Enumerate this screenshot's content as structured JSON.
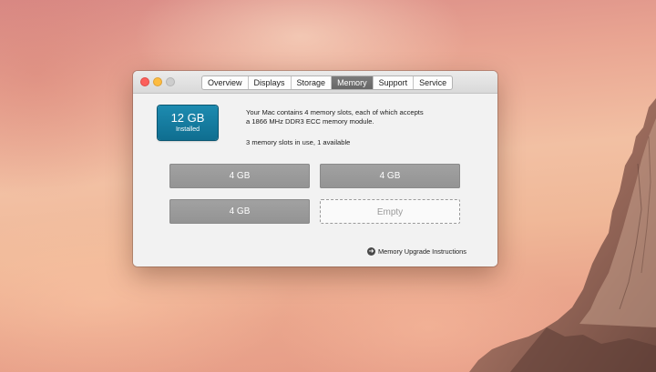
{
  "window": {
    "tabs": [
      {
        "label": "Overview",
        "active": false
      },
      {
        "label": "Displays",
        "active": false
      },
      {
        "label": "Storage",
        "active": false
      },
      {
        "label": "Memory",
        "active": true
      },
      {
        "label": "Support",
        "active": false
      },
      {
        "label": "Service",
        "active": false
      }
    ]
  },
  "memory": {
    "installed_amount": "12 GB",
    "installed_label": "Installed",
    "description_line1": "Your Mac contains 4 memory slots, each of which accepts",
    "description_line2": "a 1866 MHz DDR3 ECC memory module.",
    "usage": "3 memory slots in use, 1 available",
    "slots": [
      {
        "label": "4 GB",
        "state": "filled"
      },
      {
        "label": "4 GB",
        "state": "filled"
      },
      {
        "label": "4 GB",
        "state": "filled"
      },
      {
        "label": "Empty",
        "state": "empty"
      }
    ],
    "upgrade_link": "Memory Upgrade Instructions",
    "upgrade_icon": "arrow-right-circle-icon"
  },
  "colors": {
    "badge": "#137ba0",
    "active_tab": "#707070",
    "slot_filled": "#9a9a9a"
  }
}
